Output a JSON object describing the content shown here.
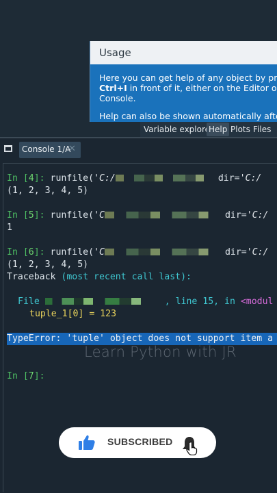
{
  "help_panel": {
    "title": "Usage",
    "line1": "Here you can get help of any object by press",
    "line2_bold": "Ctrl+I",
    "line2_rest": " in front of it, either on the Editor or the",
    "line3": "Console.",
    "line4": "Help can also be shown automatically after w"
  },
  "pane_tabs": [
    {
      "label": "Variable explorer"
    },
    {
      "label": "Help"
    },
    {
      "label": "Plots"
    },
    {
      "label": "Files"
    }
  ],
  "console_tab": {
    "label": "Console 1/A",
    "close": "✕"
  },
  "console": {
    "in4_prompt_a": "In [",
    "in4_num": "4",
    "in4_prompt_b": "]: ",
    "in4_cmd": "runfile(",
    "in4_str": "'C:/",
    "in4_dir": "dir=",
    "in4_dir_str": "'C:/",
    "out4": "(1, 2, 3, 4, 5)",
    "in5_num": "5",
    "in5_str": "'C",
    "in5_dir_str": "'C:/",
    "out5": "1",
    "in6_num": "6",
    "in6_str": "'C",
    "in6_dir_str": "'C:/",
    "out6": "(1, 2, 3, 4, 5)",
    "traceback_word": "Traceback ",
    "traceback_paren": "(most recent call last):",
    "file_word": "File ",
    "file_line": ", line 15, in ",
    "file_module": "<modul",
    "code_line": "tuple_1[0] = 123",
    "error_line": "TypeError: 'tuple' object does not support item a",
    "in7_num": "7"
  },
  "watermark": "Learn Python with JR",
  "subscribe": {
    "label": "SUBSCRIBED"
  },
  "colors": {
    "prompt_green": "#4ebf63",
    "help_blue": "#1a72bb",
    "highlight": "#1766b8"
  },
  "icons": [
    "console-icon",
    "like-icon",
    "bell-icon",
    "cursor-icon",
    "close-icon"
  ]
}
